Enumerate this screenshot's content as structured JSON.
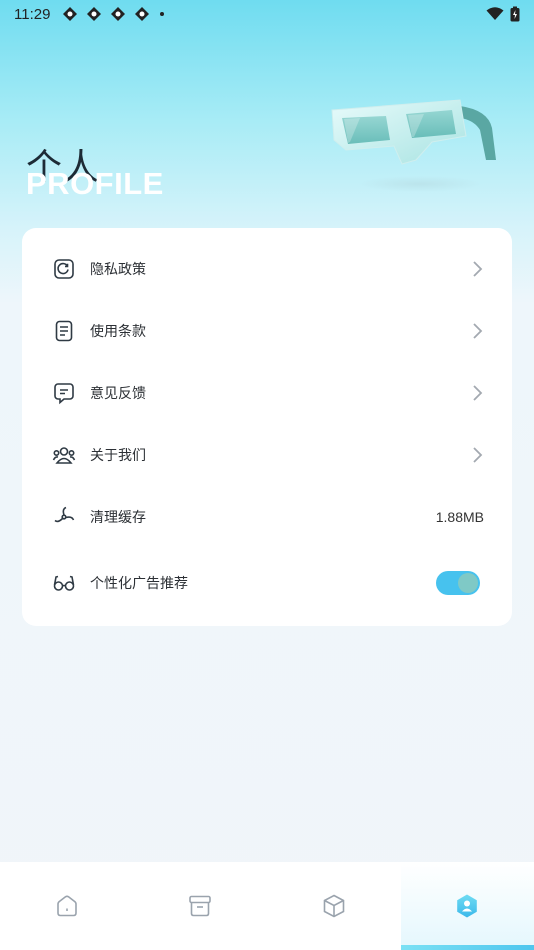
{
  "status_bar": {
    "time": "11:29",
    "icons": [
      "app-notification-icon",
      "app-notification-icon",
      "app-notification-icon",
      "app-notification-icon",
      "dot-icon"
    ],
    "right_icons": [
      "wifi-icon",
      "battery-icon"
    ]
  },
  "header": {
    "title": "个人",
    "subtitle": "PROFILE",
    "art": "3d-glasses-icon"
  },
  "menu": {
    "items": [
      {
        "label": "隐私政策",
        "icon": "privacy-icon"
      },
      {
        "label": "使用条款",
        "icon": "terms-icon"
      },
      {
        "label": "意见反馈",
        "icon": "feedback-icon"
      },
      {
        "label": "关于我们",
        "icon": "about-icon"
      },
      {
        "label": "清理缓存",
        "icon": "clear-cache-icon",
        "value": "1.88MB"
      },
      {
        "label": "个性化广告推荐",
        "icon": "glasses-icon",
        "toggle_on": true
      }
    ]
  },
  "bottom_nav": {
    "tabs": [
      {
        "icon": "home-icon",
        "active": false
      },
      {
        "icon": "archive-icon",
        "active": false
      },
      {
        "icon": "cube-icon",
        "active": false
      },
      {
        "icon": "profile-icon",
        "active": true
      }
    ]
  },
  "colors": {
    "accent": "#47c2ee",
    "toggle_knob": "#7fc9c6",
    "header_gradient_top": "#6fdcf0"
  }
}
